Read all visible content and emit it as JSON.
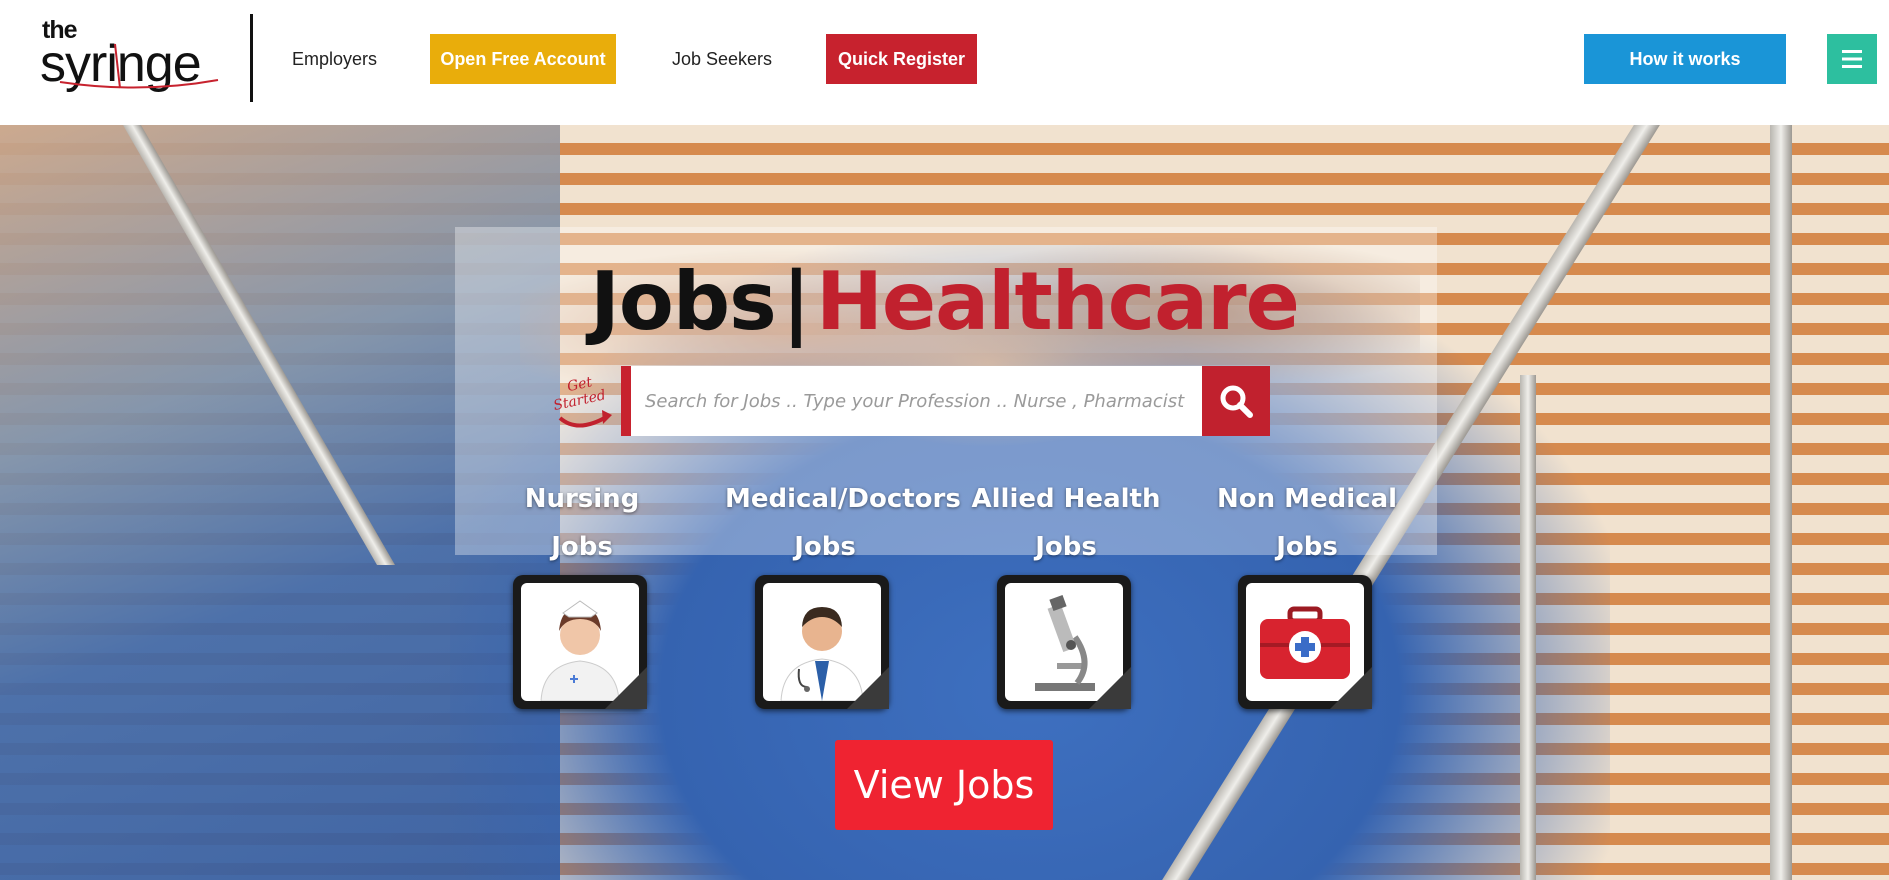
{
  "header": {
    "logo": {
      "line1": "the",
      "line2": "syringe"
    },
    "nav": {
      "employers": "Employers",
      "open_free_account": "Open Free Account",
      "job_seekers": "Job Seekers",
      "quick_register": "Quick Register",
      "how_it_works": "How it works",
      "menu_icon": "hamburger-icon"
    }
  },
  "hero": {
    "headline": {
      "part1": "Jobs",
      "separator": "|",
      "part2": "Healthcare"
    },
    "get_started": {
      "line1": "Get",
      "line2": "Started"
    },
    "search": {
      "placeholder": "Search for Jobs .. Type your Profession .. Nurse , Pharmacist , Medical O",
      "button_icon": "search-icon"
    },
    "categories": [
      {
        "line1": "Nursing",
        "line2": "Jobs",
        "icon": "nurse-icon"
      },
      {
        "line1": "Medical/Doctors",
        "line2": "Jobs",
        "icon": "doctor-icon"
      },
      {
        "line1": "Allied Health",
        "line2": "Jobs",
        "icon": "microscope-icon"
      },
      {
        "line1": "Non Medical",
        "line2": "Jobs",
        "icon": "first-aid-kit-icon"
      }
    ],
    "view_jobs": "View Jobs"
  },
  "colors": {
    "brand_red": "#c1212e",
    "yellow": "#e9ad0b",
    "blue": "#1a95d7",
    "teal": "#2dbf9f",
    "view_jobs_red": "#ef2331"
  }
}
